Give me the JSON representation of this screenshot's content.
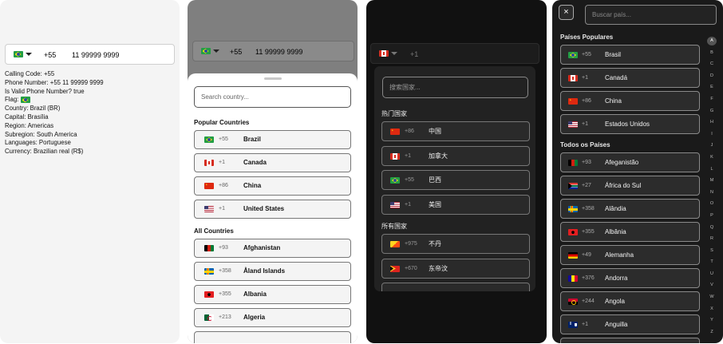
{
  "panel1": {
    "calling_code": "+55",
    "phone_number": "11 99999 9999",
    "info_lines": [
      "Calling Code: +55",
      "Phone Number: +55 11 99999 9999",
      "Is Valid Phone Number? true",
      "Flag: 🇧🇷",
      "Country: Brazil (BR)",
      "Capital: Brasília",
      "Region: Americas",
      "Subregion: South America",
      "Languages: Portuguese",
      "Currency: Brazilian real (R$)"
    ],
    "info_flag_label": "Flag: "
  },
  "panel2": {
    "calling_code": "+55",
    "phone_number": "11 99999 9999",
    "search_placeholder": "Search country...",
    "popular_title": "Popular Countries",
    "popular": [
      {
        "dial": "+55",
        "name": "Brazil",
        "flag": "br"
      },
      {
        "dial": "+1",
        "name": "Canada",
        "flag": "ca"
      },
      {
        "dial": "+86",
        "name": "China",
        "flag": "cn"
      },
      {
        "dial": "+1",
        "name": "United States",
        "flag": "us"
      }
    ],
    "all_title": "All Countries",
    "all": [
      {
        "dial": "+93",
        "name": "Afghanistan",
        "flag": "af"
      },
      {
        "dial": "+358",
        "name": "Åland Islands",
        "flag": "ax"
      },
      {
        "dial": "+355",
        "name": "Albania",
        "flag": "al"
      },
      {
        "dial": "+213",
        "name": "Algeria",
        "flag": "dz"
      }
    ]
  },
  "panel3": {
    "calling_code": "+1",
    "search_placeholder": "搜索国家...",
    "popular_title": "热门国家",
    "popular": [
      {
        "dial": "+86",
        "name": "中国",
        "flag": "cn"
      },
      {
        "dial": "+1",
        "name": "加拿大",
        "flag": "ca"
      },
      {
        "dial": "+55",
        "name": "巴西",
        "flag": "br"
      },
      {
        "dial": "+1",
        "name": "美国",
        "flag": "us"
      }
    ],
    "all_title": "所有国家",
    "all": [
      {
        "dial": "+975",
        "name": "不丹",
        "flag": "bt"
      },
      {
        "dial": "+670",
        "name": "东帝汶",
        "flag": "tl"
      }
    ]
  },
  "panel4": {
    "close_glyph": "×",
    "search_placeholder": "Buscar país...",
    "popular_title": "Países Populares",
    "popular": [
      {
        "dial": "+55",
        "name": "Brasil",
        "flag": "br"
      },
      {
        "dial": "+1",
        "name": "Canadá",
        "flag": "ca"
      },
      {
        "dial": "+86",
        "name": "China",
        "flag": "cn"
      },
      {
        "dial": "+1",
        "name": "Estados Unidos",
        "flag": "us"
      }
    ],
    "all_title": "Todos os Países",
    "all": [
      {
        "dial": "+93",
        "name": "Afeganistão",
        "flag": "af"
      },
      {
        "dial": "+27",
        "name": "África do Sul",
        "flag": "za"
      },
      {
        "dial": "+358",
        "name": "Alândia",
        "flag": "ax"
      },
      {
        "dial": "+355",
        "name": "Albânia",
        "flag": "al"
      },
      {
        "dial": "+49",
        "name": "Alemanha",
        "flag": "de"
      },
      {
        "dial": "+376",
        "name": "Andorra",
        "flag": "ad"
      },
      {
        "dial": "+244",
        "name": "Angola",
        "flag": "ao"
      },
      {
        "dial": "+1",
        "name": "Anguilla",
        "flag": "ai"
      }
    ],
    "alphabet": [
      "A",
      "B",
      "C",
      "D",
      "E",
      "F",
      "G",
      "H",
      "I",
      "J",
      "K",
      "L",
      "M",
      "N",
      "O",
      "P",
      "Q",
      "R",
      "S",
      "T",
      "U",
      "V",
      "W",
      "X",
      "Y",
      "Z"
    ],
    "active_letter": "A"
  }
}
